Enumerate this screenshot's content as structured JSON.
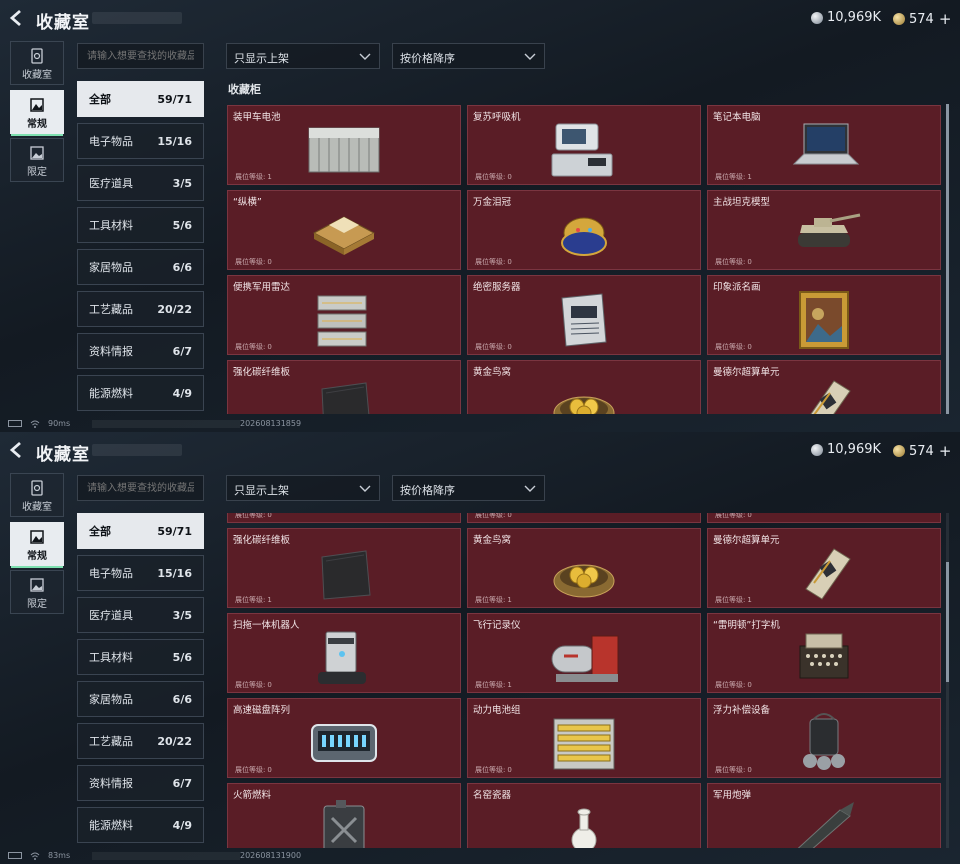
{
  "header": {
    "title": "收藏室",
    "currency_silver": "10,969K",
    "currency_gold": "574",
    "currency_gold_plus": "+"
  },
  "sidebar": [
    {
      "label": "收藏室",
      "icon": "vault-icon"
    },
    {
      "label": "常规",
      "icon": "frame-icon",
      "active": true
    },
    {
      "label": "限定",
      "icon": "image-icon"
    }
  ],
  "search": {
    "placeholder": "请输入想要查找的收藏品"
  },
  "filters": {
    "listing": "只显示上架",
    "sort": "按价格降序"
  },
  "categories": [
    {
      "label": "全部",
      "count": "59/71",
      "active": true
    },
    {
      "label": "电子物品",
      "count": "15/16"
    },
    {
      "label": "医疗道具",
      "count": "3/5"
    },
    {
      "label": "工具材料",
      "count": "5/6"
    },
    {
      "label": "家居物品",
      "count": "6/6"
    },
    {
      "label": "工艺藏品",
      "count": "20/22"
    },
    {
      "label": "资料情报",
      "count": "6/7"
    },
    {
      "label": "能源燃料",
      "count": "4/9"
    }
  ],
  "section_title": "收藏柜",
  "level_label": "展位等级:",
  "top_items": [
    {
      "name": "装甲车电池",
      "level": "1",
      "icon": "battery-icon"
    },
    {
      "name": "复苏呼吸机",
      "level": "0",
      "icon": "ventilator-icon"
    },
    {
      "name": "笔记本电脑",
      "level": "1",
      "icon": "laptop-icon"
    },
    {
      "name": "“纵横”",
      "level": "0",
      "icon": "chessboard-icon"
    },
    {
      "name": "万金泪冠",
      "level": "0",
      "icon": "jewel-egg-icon"
    },
    {
      "name": "主战坦克模型",
      "level": "0",
      "icon": "tank-icon"
    },
    {
      "name": "便携军用雷达",
      "level": "0",
      "icon": "radar-icon"
    },
    {
      "name": "绝密服务器",
      "level": "0",
      "icon": "server-icon"
    },
    {
      "name": "印象派名画",
      "level": "0",
      "icon": "painting-icon"
    },
    {
      "name": "强化碳纤维板",
      "level": "",
      "icon": "carbon-plate-icon"
    },
    {
      "name": "黄金鸟窝",
      "level": "",
      "icon": "golden-nest-icon"
    },
    {
      "name": "曼德尔超算单元",
      "level": "",
      "icon": "compute-unit-icon"
    }
  ],
  "bottom_items": [
    {
      "name": "",
      "level": "0",
      "icon": "partial-icon"
    },
    {
      "name": "",
      "level": "0",
      "icon": "partial-icon"
    },
    {
      "name": "",
      "level": "0",
      "icon": "partial-icon"
    },
    {
      "name": "强化碳纤维板",
      "level": "1",
      "icon": "carbon-plate-icon"
    },
    {
      "name": "黄金鸟窝",
      "level": "1",
      "icon": "golden-nest-icon"
    },
    {
      "name": "曼德尔超算单元",
      "level": "1",
      "icon": "compute-unit-icon"
    },
    {
      "name": "扫拖一体机器人",
      "level": "0",
      "icon": "robot-vacuum-icon"
    },
    {
      "name": "飞行记录仪",
      "level": "1",
      "icon": "flight-recorder-icon"
    },
    {
      "name": "“雷明顿”打字机",
      "level": "0",
      "icon": "typewriter-icon"
    },
    {
      "name": "高速磁盘阵列",
      "level": "0",
      "icon": "disk-array-icon"
    },
    {
      "name": "动力电池组",
      "level": "0",
      "icon": "battery-pack-icon"
    },
    {
      "name": "浮力补偿设备",
      "level": "0",
      "icon": "buoyancy-device-icon"
    },
    {
      "name": "火箭燃料",
      "level": "",
      "icon": "fuel-canister-icon"
    },
    {
      "name": "名窑瓷器",
      "level": "",
      "icon": "porcelain-icon"
    },
    {
      "name": "军用炮弹",
      "level": "",
      "icon": "shell-icon"
    }
  ],
  "status_top": {
    "ping": "90ms",
    "timestamp": "202608131859"
  },
  "status_bottom": {
    "ping": "83ms",
    "timestamp": "202608131900"
  }
}
